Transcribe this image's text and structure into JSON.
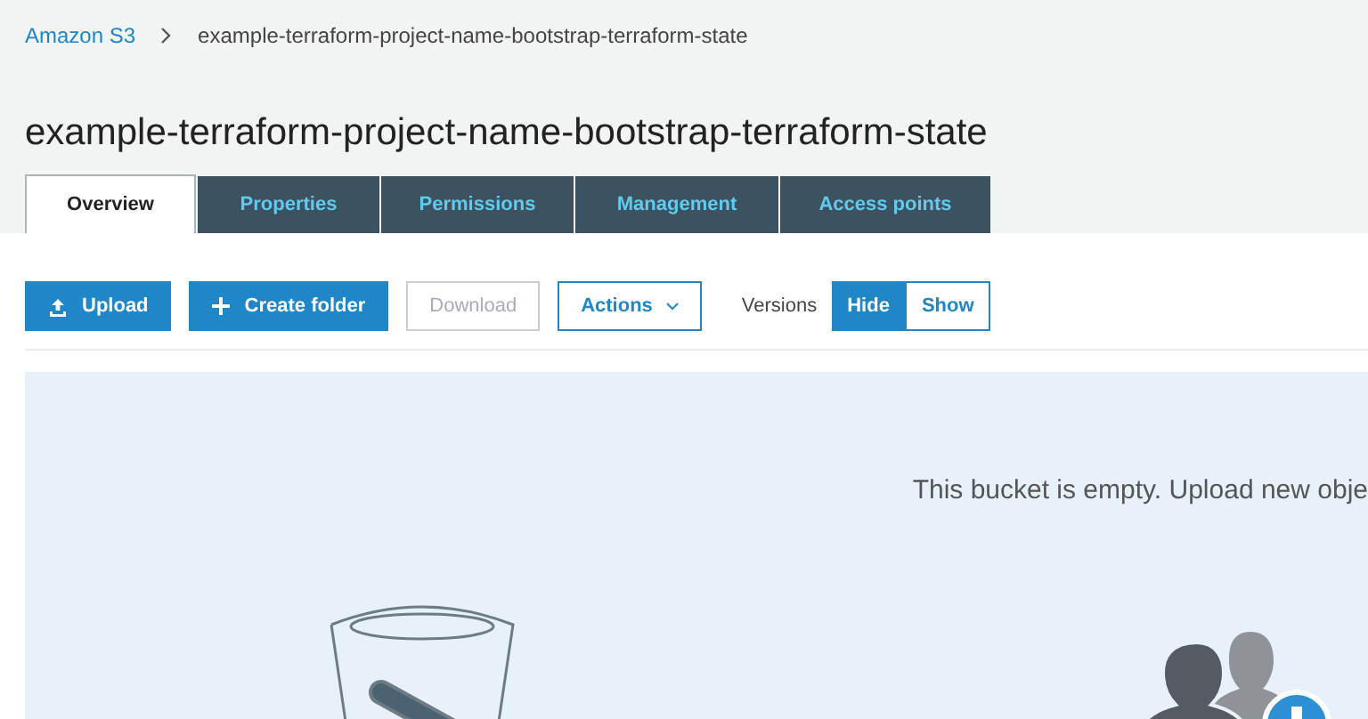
{
  "breadcrumb": [
    {
      "label": "Amazon S3",
      "kind": "link"
    },
    {
      "label": "example-terraform-project-name-bootstrap-terraform-state",
      "kind": "current"
    }
  ],
  "title": "example-terraform-project-name-bootstrap-terraform-state",
  "tabs": [
    {
      "label": "Overview",
      "selected": true
    },
    {
      "label": "Properties",
      "selected": false
    },
    {
      "label": "Permissions",
      "selected": false
    },
    {
      "label": "Management",
      "selected": false
    },
    {
      "label": "Access points",
      "selected": false
    }
  ],
  "toolbar": [
    {
      "kind": "upload",
      "label": "Upload"
    },
    {
      "kind": "create",
      "label": "Create folder"
    },
    {
      "kind": "plain",
      "label": "Download",
      "disabled": true
    },
    {
      "kind": "dropdown",
      "label": "Actions"
    }
  ],
  "versions": {
    "label": "Versions",
    "options": [
      {
        "label": "Hide",
        "selected": true
      },
      {
        "label": "Show",
        "selected": false
      }
    ]
  },
  "empty_message": "This bucket is empty. Upload new obje"
}
